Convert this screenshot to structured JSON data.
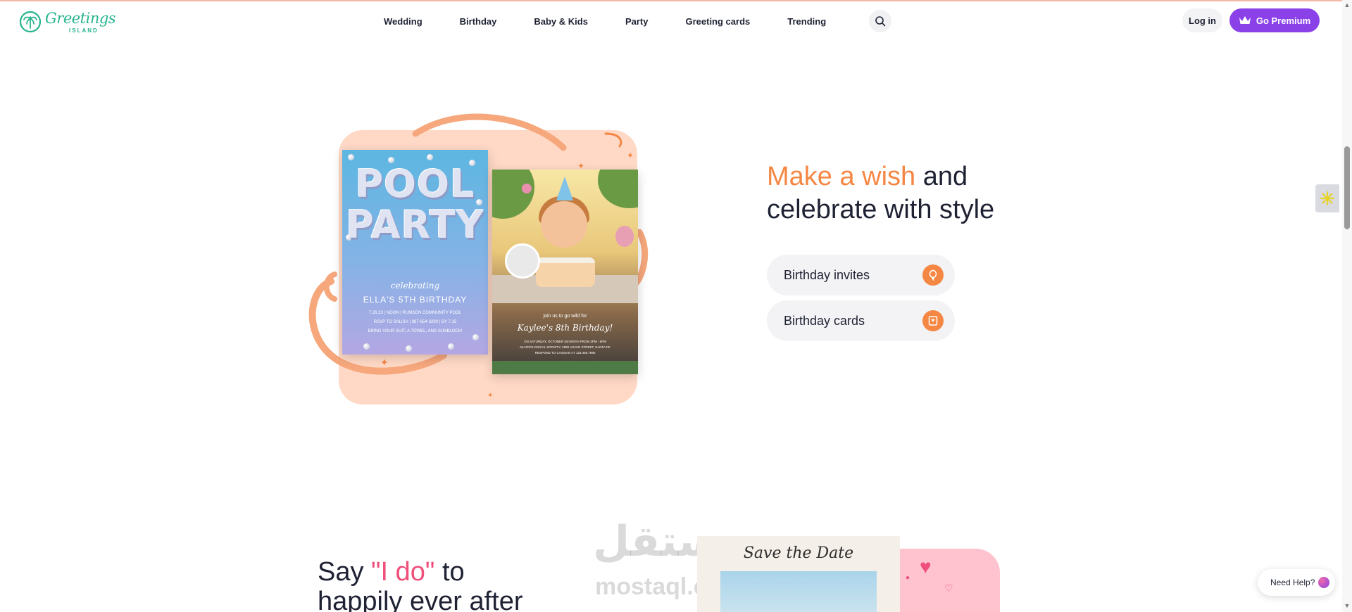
{
  "brand": {
    "name": "Greetings",
    "sub": "ISLAND",
    "accent_color": "#27b48e"
  },
  "nav": {
    "items": [
      {
        "label": "Wedding"
      },
      {
        "label": "Birthday"
      },
      {
        "label": "Baby & Kids"
      },
      {
        "label": "Party"
      },
      {
        "label": "Greeting cards"
      },
      {
        "label": "Trending"
      }
    ],
    "search_icon": "search-icon"
  },
  "header_actions": {
    "login_label": "Log in",
    "premium_label": "Go Premium",
    "premium_color": "#8a42e8"
  },
  "hero": {
    "title_accent": "Make a wish",
    "title_rest_1": "and",
    "title_rest_2": "celebrate with style",
    "accent_color": "#f58744",
    "links": [
      {
        "label": "Birthday invites",
        "icon": "balloon-icon"
      },
      {
        "label": "Birthday cards",
        "icon": "card-icon"
      }
    ],
    "pool_card": {
      "title": "POOL PARTY",
      "celebrating": "celebrating",
      "name": "ELLA'S 5TH BIRTHDAY",
      "line1": "7.26.23 | NOON | RUMSON COMMUNITY POOL",
      "line2": "RSVP TO SALISH | 987-654-3290 | BY 7.15",
      "line3": "BRING YOUR SUIT, A TOWEL, AND SUNBLOCK!"
    },
    "bday_card": {
      "intro": "join us to go wild for",
      "name": "Kaylee's 8th Birthday!",
      "line1": "ON SATURDAY, OCTOBER SEVENTH FROM 2PM - 5PM",
      "line2": "NH ZOOLOGICAL SOCIETY, 2890 AGAVE STREET, SANTA FE",
      "line3": "RESPOND TO CASSIAN AT 123.456.7890"
    }
  },
  "wedding": {
    "title_1": "Say ",
    "title_accent": "\"I do\"",
    "title_2": " to",
    "title_3": "happily ever after",
    "accent_color": "#ef4f7b",
    "card_title": "Save the Date"
  },
  "watermark": {
    "text": "مستقل",
    "sub": "mostaql.com"
  },
  "widgets": {
    "help_label": "Need Help?"
  }
}
